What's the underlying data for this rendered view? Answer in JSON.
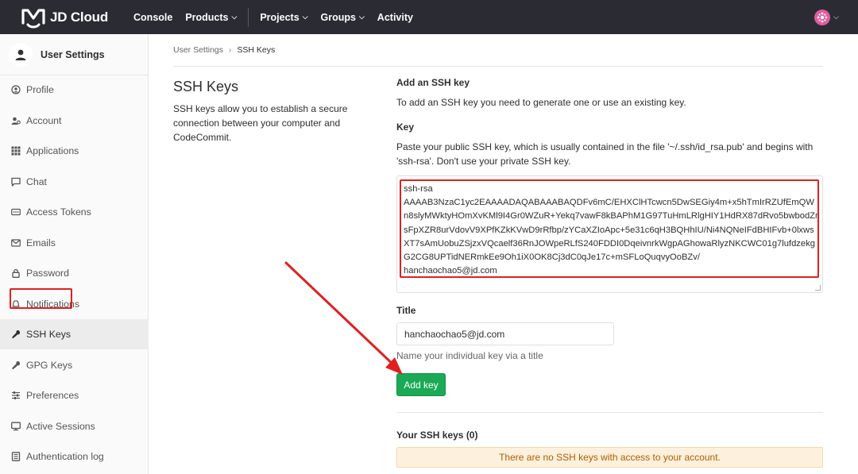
{
  "navbar": {
    "brand": "JD Cloud",
    "links": [
      {
        "label": "Console",
        "has_caret": false
      },
      {
        "label": "Products",
        "has_caret": true
      },
      {
        "label": "Projects",
        "has_caret": true
      },
      {
        "label": "Groups",
        "has_caret": true
      },
      {
        "label": "Activity",
        "has_caret": false
      }
    ],
    "avatar_color": "#e15b9f"
  },
  "sidebar": {
    "title": "User Settings",
    "items": [
      {
        "label": "Profile",
        "icon": "profile-icon",
        "active": false
      },
      {
        "label": "Account",
        "icon": "account-icon",
        "active": false
      },
      {
        "label": "Applications",
        "icon": "applications-icon",
        "active": false
      },
      {
        "label": "Chat",
        "icon": "chat-icon",
        "active": false
      },
      {
        "label": "Access Tokens",
        "icon": "access-tokens-icon",
        "active": false
      },
      {
        "label": "Emails",
        "icon": "emails-icon",
        "active": false
      },
      {
        "label": "Password",
        "icon": "lock-icon",
        "active": false
      },
      {
        "label": "Notifications",
        "icon": "bell-icon",
        "active": false
      },
      {
        "label": "SSH Keys",
        "icon": "key-icon",
        "active": true
      },
      {
        "label": "GPG Keys",
        "icon": "key-icon",
        "active": false
      },
      {
        "label": "Preferences",
        "icon": "sliders-icon",
        "active": false
      },
      {
        "label": "Active Sessions",
        "icon": "monitor-icon",
        "active": false
      },
      {
        "label": "Authentication log",
        "icon": "log-icon",
        "active": false
      }
    ]
  },
  "breadcrumb": {
    "parent": "User Settings",
    "separator": "›",
    "current": "SSH Keys"
  },
  "description": {
    "title": "SSH Keys",
    "text": "SSH keys allow you to establish a secure connection between your computer and CodeCommit."
  },
  "form": {
    "title": "Add an SSH key",
    "intro": "To add an SSH key you need to generate one or use an existing key.",
    "key_label": "Key",
    "key_help": "Paste your public SSH key, which is usually contained in the file '~/.ssh/id_rsa.pub' and begins with 'ssh-rsa'. Don't use your private SSH key.",
    "key_value": "ssh-rsa\nAAAAB3NzaC1yc2EAAAADAQABAAABAQDFv6mC/EHXClHTcwcn5DwSEGiy4m+x5hTmIrRZUfEmQWn8slyMWktyHOmXvKMl9I4Gr0WZuR+Yekq7vawF8kBAPhM1G97TuHmLRlgHIY1HdRX87dRvo5bwbodZrsFpXZR8urVdovV9XPfKZkKVwD9rRfbp/zYCaXZIoApc+5e31c6qH3BQHhIU/Ni4NQNeIFdBHIFvb+0lxwsXT7sAmUobuZSjzxVQcaelf36RnJOWpeRLfS240FDDI0DqeivnrkWgpAGhowaRlyzNKCWC01g7lufdzekgG2CG8UPTidNERmkEe9Oh1iX0OK8Cj3dC0qJe17c+mSFLoQuqvyOoBZv/\nhanchaochao5@jd.com",
    "title_label": "Title",
    "title_value": "hanchaochao5@jd.com",
    "title_help": "Name your individual key via a title",
    "add_button": "Add key",
    "keys_heading": "Your SSH keys (0)",
    "empty_message": "There are no SSH keys with access to your account."
  },
  "colors": {
    "navbar_bg": "#2b2c33",
    "primary_button": "#1aaa55",
    "annotation_red": "#e02020",
    "alert_bg": "#fdf1dd",
    "alert_text": "#b35a00"
  }
}
